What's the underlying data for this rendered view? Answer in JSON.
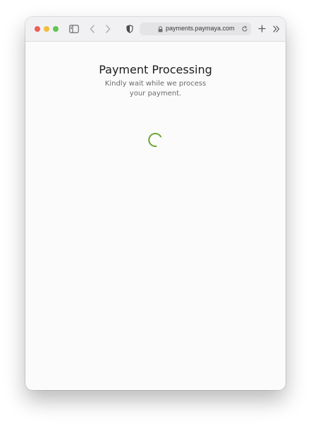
{
  "browser": {
    "url": "payments.paymaya.com"
  },
  "page": {
    "title": "Payment Processing",
    "subtitle": "Kindly wait while we process your payment."
  },
  "colors": {
    "spinner": "#6ba534"
  }
}
